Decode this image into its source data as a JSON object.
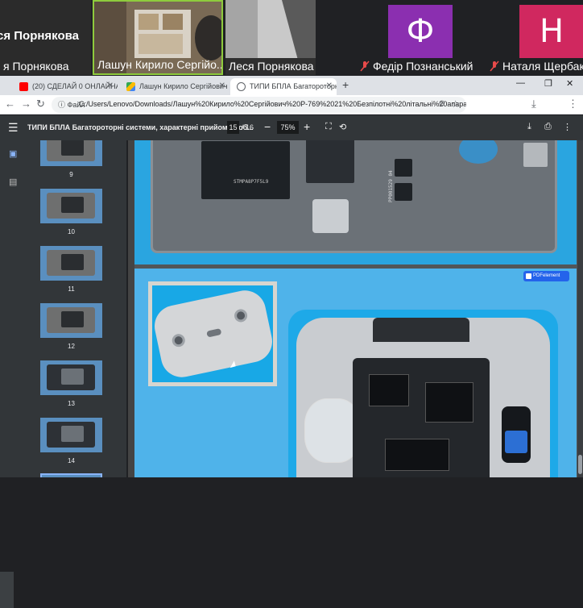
{
  "call": {
    "self_name": "ся Порнякова",
    "tiles": [
      {
        "label": "я Порнякова"
      },
      {
        "label": "Лашун Кирило Сергійо..."
      },
      {
        "label": "Леся Порнякова"
      },
      {
        "label": "Федір Познанський",
        "avatar": "Ф",
        "muted": true,
        "color": "#8b2fb0"
      },
      {
        "label": "Наталя Щербак",
        "avatar": "Н",
        "muted": true,
        "color": "#d0285f"
      }
    ]
  },
  "browser": {
    "tabs": [
      {
        "label": "(20) СДЕЛАЙ 0 ОНЛАЙНА Н...",
        "favicon": "youtube-icon"
      },
      {
        "label": "Лашун Кирило Сергійович Р...",
        "favicon": "drive-icon"
      },
      {
        "label": "ТИПИ БПЛА Багатороторні с...",
        "favicon": "globe-icon",
        "active": true
      }
    ],
    "new_tab": "+",
    "address": {
      "chip": "Файл",
      "url": "C:/Users/Lenovo/Downloads/Лашун%20Кирило%20Сергійович%20P-769%2021%20Безпілотні%20літальні%20апарати..."
    }
  },
  "pdf": {
    "title": "ТИПИ БПЛА Багатороторні системи, характерні прийоми роб...",
    "current_page": "15",
    "total_pages": "/ 16",
    "zoom": "75%",
    "thumbnails": [
      "9",
      "10",
      "11",
      "12",
      "13",
      "14"
    ],
    "pcb_label": "PP001529 04",
    "chip_label": "STMPA8P7F5L9",
    "watermark": "PDFelement"
  }
}
